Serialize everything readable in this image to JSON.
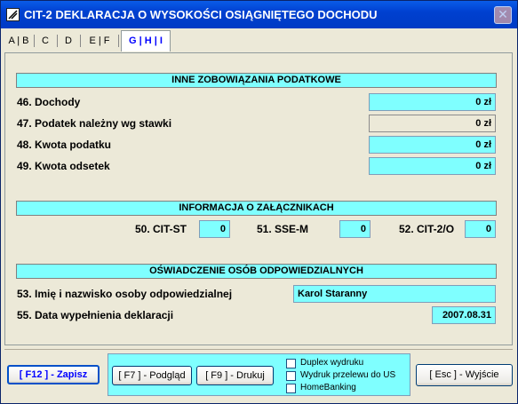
{
  "window": {
    "title": "CIT-2 DEKLARACJA O WYSOKOŚCI OSIĄGNIĘTEGO DOCHODU",
    "close_glyph": "✕"
  },
  "tabs": [
    {
      "label": "A | B"
    },
    {
      "label": "C"
    },
    {
      "label": "D"
    },
    {
      "label": "E | F"
    },
    {
      "label": "G | H | I",
      "active": true
    }
  ],
  "section_obligations": {
    "header": "INNE ZOBOWIĄZANIA PODATKOWE",
    "rows": [
      {
        "label": "46.  Dochody",
        "value": "0 zł"
      },
      {
        "label": "47.  Podatek należny wg stawki",
        "value": "0 zł"
      },
      {
        "label": "48.  Kwota podatku",
        "value": "0 zł"
      },
      {
        "label": "49.  Kwota odsetek",
        "value": "0 zł"
      }
    ]
  },
  "section_attachments": {
    "header": "INFORMACJA O ZAŁĄCZNIKACH",
    "items": [
      {
        "label": "50. CIT-ST",
        "value": "0"
      },
      {
        "label": "51. SSE-M",
        "value": "0"
      },
      {
        "label": "52. CIT-2/O",
        "value": "0"
      }
    ]
  },
  "section_statement": {
    "header": "OŚWIADCZENIE OSÓB ODPOWIEDZIALNYCH",
    "person_label": "53.  Imię i nazwisko osoby odpowiedzialnej",
    "person_value": "Karol Staranny",
    "date_label": "55.  Data wypełnienia deklaracji",
    "date_value": "2007.08.31"
  },
  "footer": {
    "save_label": "[ F12 ] - Zapisz",
    "preview_label": "[ F7 ] - Podgląd",
    "print_label": "[ F9 ] - Drukuj",
    "checkboxes": [
      {
        "label": "Duplex wydruku",
        "checked": false
      },
      {
        "label": "Wydruk przelewu do US",
        "checked": false
      },
      {
        "label": "HomeBanking",
        "checked": false
      }
    ],
    "exit_label": "[ Esc ] - Wyjście"
  },
  "colors": {
    "titlebar": "#0040d0",
    "field_fill": "#7fffff",
    "panel_bg": "#ece9d8",
    "accent_text": "#0000ff"
  }
}
